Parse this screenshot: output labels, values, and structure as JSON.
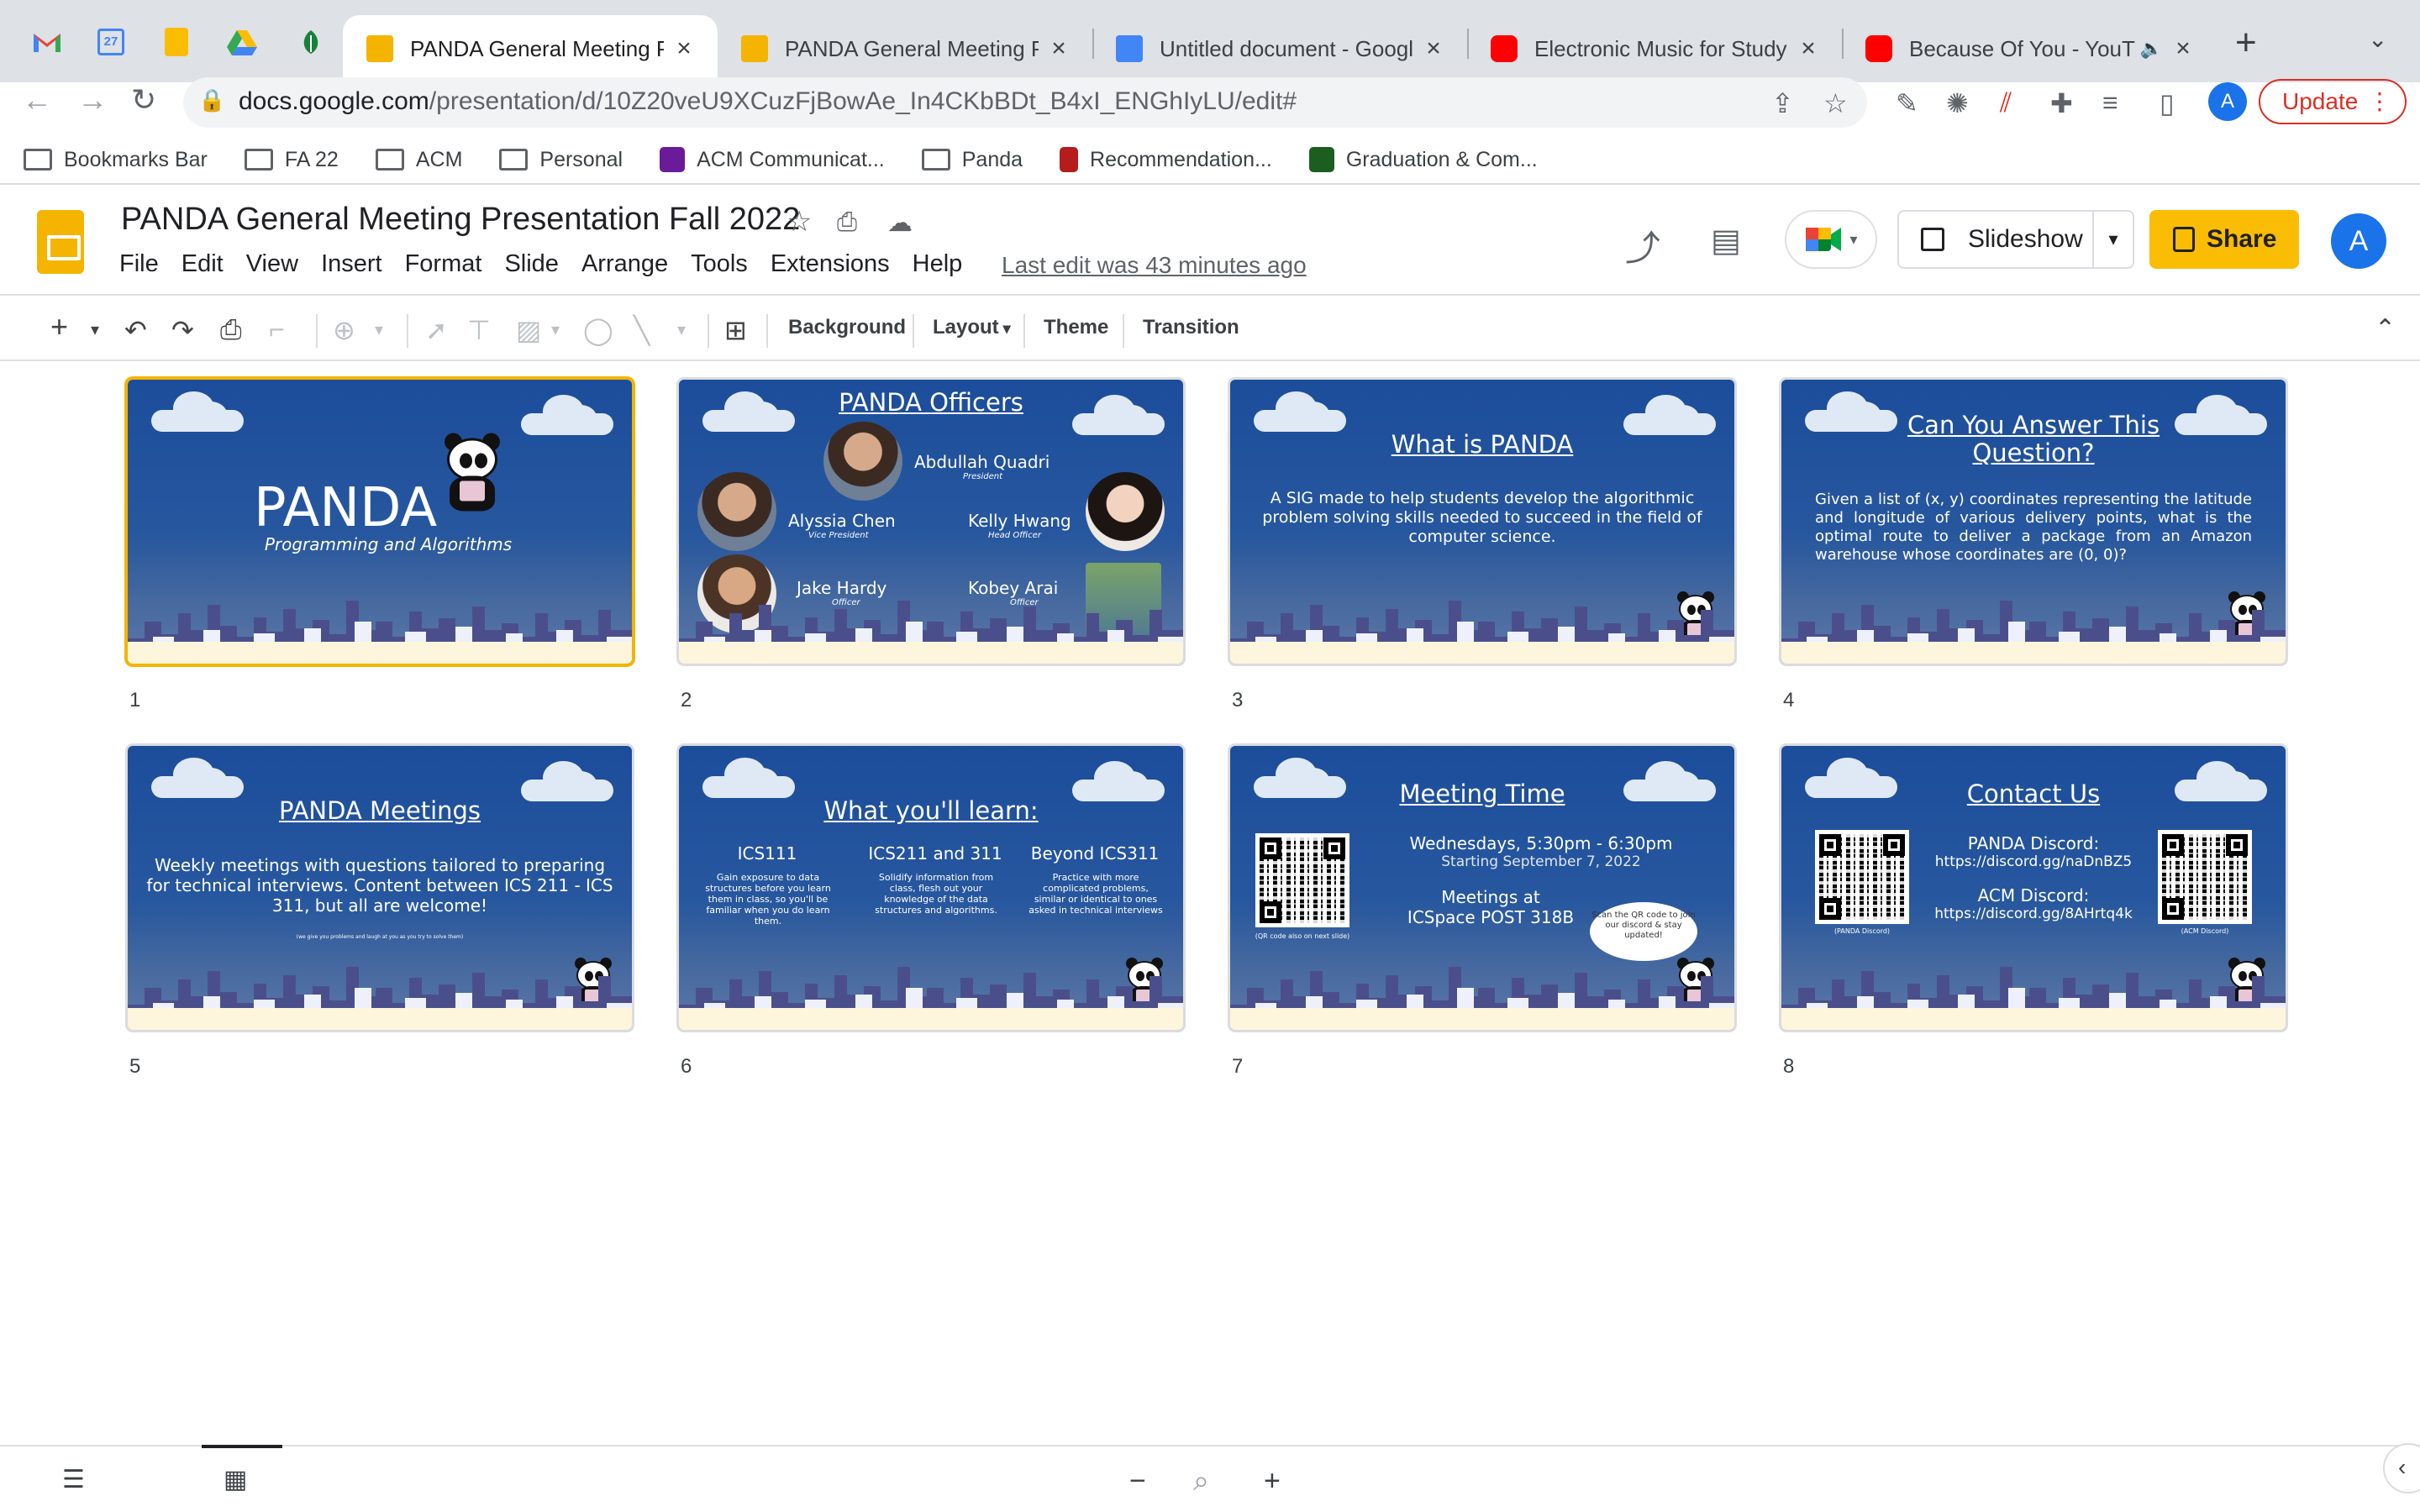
{
  "browser": {
    "pinned_tabs": [
      {
        "icon": "gmail-icon",
        "color": "#ea4335"
      },
      {
        "icon": "calendar-icon",
        "color": "#4285f4",
        "text": "27"
      },
      {
        "icon": "keep-icon",
        "color": "#fbbc04"
      },
      {
        "icon": "drive-icon",
        "color": "#34a853"
      },
      {
        "icon": "leaf-icon",
        "color": "#188038"
      }
    ],
    "tabs": [
      {
        "title": "PANDA General Meeting Pre",
        "icon": "slides-icon",
        "active": true
      },
      {
        "title": "PANDA General Meeting Pre",
        "icon": "slides-icon",
        "active": false
      },
      {
        "title": "Untitled document - Google",
        "icon": "docs-icon",
        "active": false
      },
      {
        "title": "Electronic Music for Studyin",
        "icon": "youtube-icon",
        "active": false
      },
      {
        "title": "Because Of You - YouTu",
        "icon": "youtube-icon",
        "active": false
      }
    ],
    "url_host": "docs.google.com",
    "url_path": "/presentation/d/10Z20veU9XCuzFjBowAe_In4CKbBDt_B4xI_ENGhIyLU/edit#",
    "profile_initial": "A",
    "update_label": "Update",
    "bookmarks": [
      {
        "label": "Bookmarks Bar",
        "icon": "folder-icon"
      },
      {
        "label": "FA 22",
        "icon": "folder-icon"
      },
      {
        "label": "ACM",
        "icon": "folder-icon"
      },
      {
        "label": "Personal",
        "icon": "folder-icon"
      },
      {
        "label": "ACM Communicat...",
        "icon": "acm-icon"
      },
      {
        "label": "Panda",
        "icon": "folder-icon"
      },
      {
        "label": "Recommendation...",
        "icon": "recommendation-icon"
      },
      {
        "label": "Graduation & Com...",
        "icon": "uh-icon"
      }
    ]
  },
  "app": {
    "doc_title": "PANDA General Meeting Presentation Fall 2022",
    "menu": [
      "File",
      "Edit",
      "View",
      "Insert",
      "Format",
      "Slide",
      "Arrange",
      "Tools",
      "Extensions",
      "Help"
    ],
    "last_edit": "Last edit was 43 minutes ago",
    "slideshow_label": "Slideshow",
    "share_label": "Share",
    "account_initial": "A",
    "accent": "#fbbc04"
  },
  "toolbar": {
    "background_label": "Background",
    "layout_label": "Layout",
    "theme_label": "Theme",
    "transition_label": "Transition"
  },
  "slides": {
    "s1": {
      "num": "1",
      "title": "PANDA",
      "subtitle": "Programming and Algorithms"
    },
    "s2": {
      "num": "2",
      "title": "PANDA Officers",
      "officers": [
        {
          "name": "Abdullah Quadri",
          "role": "President"
        },
        {
          "name": "Alyssia Chen",
          "role": "Vice President"
        },
        {
          "name": "Kelly Hwang",
          "role": "Head Officer"
        },
        {
          "name": "Jake Hardy",
          "role": "Officer"
        },
        {
          "name": "Kobey Arai",
          "role": "Officer"
        }
      ]
    },
    "s3": {
      "num": "3",
      "title": "What is PANDA",
      "body": "A SIG made to help students develop the algorithmic problem solving skills needed to succeed in the field of computer science."
    },
    "s4": {
      "num": "4",
      "title": "Can You Answer This Question?",
      "body": "Given a list of (x, y) coordinates representing the latitude and longitude of various delivery points, what is the optimal route to deliver a package from an Amazon warehouse whose coordinates are (0, 0)?"
    },
    "s5": {
      "num": "5",
      "title": "PANDA Meetings",
      "body": "Weekly meetings with questions tailored to preparing for technical interviews.  Content between ICS 211 - ICS 311, but all are welcome!",
      "fine": "(we give you problems and laugh at you as you try to solve them)"
    },
    "s6": {
      "num": "6",
      "title": "What you'll learn:",
      "cols": [
        {
          "head": "ICS111",
          "body": "Gain exposure to data structures before you learn them in class, so you'll be familiar when you do learn them."
        },
        {
          "head": "ICS211 and 311",
          "body": "Solidify information from class, flesh out your knowledge of the data structures and algorithms."
        },
        {
          "head": "Beyond ICS311",
          "body": "Practice with more complicated problems, similar or identical to ones asked in technical interviews"
        }
      ]
    },
    "s7": {
      "num": "7",
      "title": "Meeting Time",
      "when": "Wednesdays, 5:30pm - 6:30pm",
      "start": "Starting September 7, 2022",
      "where": "Meetings at ICSpace POST 318B",
      "qr_caption": "(QR code also on next slide)",
      "bubble": "Scan the QR code to join our discord & stay updated!"
    },
    "s8": {
      "num": "8",
      "title": "Contact Us",
      "panda_label": "PANDA Discord:",
      "panda_link": "https://discord.gg/naDnBZ5",
      "acm_label": "ACM Discord:",
      "acm_link": "https://discord.gg/8AHrtq4k",
      "qr_left_caption": "(PANDA Discord)",
      "qr_right_caption": "(ACM Discord)"
    }
  }
}
